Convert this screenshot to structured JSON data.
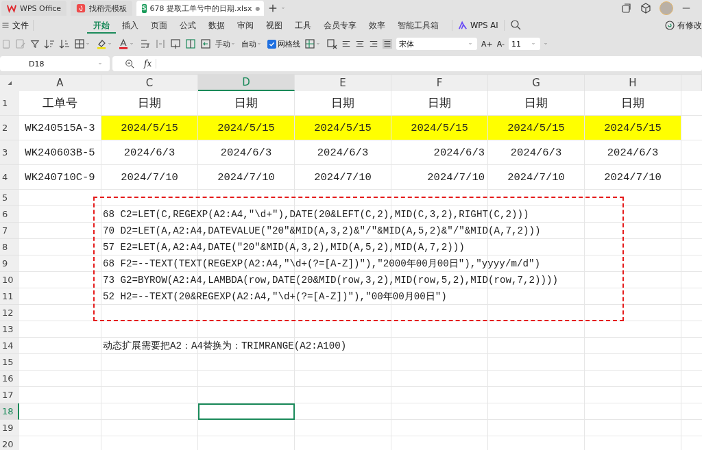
{
  "window_tabs": [
    {
      "label": "WPS Office",
      "selected": false,
      "kind": "home"
    },
    {
      "label": "找稻壳模板",
      "selected": false,
      "kind": "template"
    },
    {
      "label": "678 提取工单号中的日期.xlsx",
      "selected": true,
      "kind": "sheet",
      "icon_letter": "S",
      "unsaved_mark": "●"
    }
  ],
  "menu": {
    "file": "文件",
    "tabs": [
      {
        "label": "开始",
        "selected": true
      },
      {
        "label": "插入",
        "selected": false
      },
      {
        "label": "页面",
        "selected": false
      },
      {
        "label": "公式",
        "selected": false
      },
      {
        "label": "数据",
        "selected": false
      },
      {
        "label": "审阅",
        "selected": false
      },
      {
        "label": "视图",
        "selected": false
      },
      {
        "label": "工具",
        "selected": false
      },
      {
        "label": "会员专享",
        "selected": false
      },
      {
        "label": "效率",
        "selected": false
      },
      {
        "label": "智能工具箱",
        "selected": false
      }
    ],
    "ai": "WPS AI",
    "status": "有修改"
  },
  "toolbar": {
    "row_height": "手动",
    "autofit": "自动",
    "gridlines": {
      "label": "网格线",
      "checked": true
    },
    "font": "宋体",
    "grow_font": "A+",
    "shrink_font": "A-",
    "font_size": "11"
  },
  "formula_bar": {
    "name_box": "D18",
    "fx": "fx"
  },
  "columns": [
    {
      "letter": "A",
      "selected": false
    },
    {
      "letter": "C",
      "selected": false
    },
    {
      "letter": "D",
      "selected": true
    },
    {
      "letter": "E",
      "selected": false
    },
    {
      "letter": "F",
      "selected": false
    },
    {
      "letter": "G",
      "selected": false
    },
    {
      "letter": "H",
      "selected": false
    }
  ],
  "rows": [
    {
      "number": "1",
      "selected": false,
      "highlighted": false,
      "header": true,
      "cells": [
        {
          "text": "工单号"
        },
        {
          "text": "日期"
        },
        {
          "text": "日期"
        },
        {
          "text": "日期"
        },
        {
          "text": "日期"
        },
        {
          "text": "日期"
        },
        {
          "text": "日期"
        }
      ]
    },
    {
      "number": "2",
      "selected": false,
      "highlighted": true,
      "cells": [
        {
          "text": "WK240515A-3"
        },
        {
          "text": "2024/5/15"
        },
        {
          "text": "2024/5/15"
        },
        {
          "text": "2024/5/15"
        },
        {
          "text": "2024/5/15"
        },
        {
          "text": "2024/5/15"
        },
        {
          "text": "2024/5/15"
        }
      ]
    },
    {
      "number": "3",
      "selected": false,
      "highlighted": false,
      "cells": [
        {
          "text": "WK240603B-5"
        },
        {
          "text": "2024/6/3"
        },
        {
          "text": "2024/6/3"
        },
        {
          "text": "2024/6/3"
        },
        {
          "text": "2024/6/3",
          "right_aligned": true
        },
        {
          "text": "2024/6/3"
        },
        {
          "text": "2024/6/3"
        }
      ]
    },
    {
      "number": "4",
      "selected": false,
      "highlighted": false,
      "cells": [
        {
          "text": "WK240710C-9"
        },
        {
          "text": "2024/7/10"
        },
        {
          "text": "2024/7/10"
        },
        {
          "text": "2024/7/10"
        },
        {
          "text": "2024/7/10",
          "right_aligned": true
        },
        {
          "text": "2024/7/10"
        },
        {
          "text": "2024/7/10"
        }
      ]
    },
    {
      "number": "5",
      "selected": false
    },
    {
      "number": "6",
      "selected": false,
      "note": "68 C2=LET(C,REGEXP(A2:A4,\"\\d+\"),DATE(20&LEFT(C,2),MID(C,3,2),RIGHT(C,2)))"
    },
    {
      "number": "7",
      "selected": false,
      "note": "70 D2=LET(A,A2:A4,DATEVALUE(\"20\"&MID(A,3,2)&\"/\"&MID(A,5,2)&\"/\"&MID(A,7,2)))"
    },
    {
      "number": "8",
      "selected": false,
      "note": "57 E2=LET(A,A2:A4,DATE(\"20\"&MID(A,3,2),MID(A,5,2),MID(A,7,2)))"
    },
    {
      "number": "9",
      "selected": false,
      "note": "68 F2=--TEXT(TEXT(REGEXP(A2:A4,\"\\d+(?=[A-Z])\"),\"2000年00月00日\"),\"yyyy/m/d\")"
    },
    {
      "number": "10",
      "selected": false,
      "note": "73 G2=BYROW(A2:A4,LAMBDA(row,DATE(20&MID(row,3,2),MID(row,5,2),MID(row,7,2))))"
    },
    {
      "number": "11",
      "selected": false,
      "note": "52 H2=--TEXT(20&REGEXP(A2:A4,\"\\d+(?=[A-Z])\"),\"00年00月00日\")"
    },
    {
      "number": "12",
      "selected": false
    },
    {
      "number": "13",
      "selected": false
    },
    {
      "number": "14",
      "selected": false,
      "note": "动态扩展需要把A2：A4替换为：TRIMRANGE(A2:A100)"
    },
    {
      "number": "15",
      "selected": false
    },
    {
      "number": "16",
      "selected": false
    },
    {
      "number": "17",
      "selected": false
    },
    {
      "number": "18",
      "selected": true
    },
    {
      "number": "19",
      "selected": false
    },
    {
      "number": "20",
      "selected": false
    }
  ]
}
